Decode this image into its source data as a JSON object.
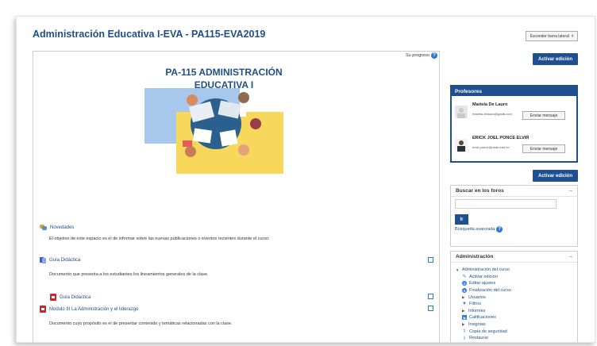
{
  "header": {
    "title": "Administración Educativa I-EVA - PA115-EVA2019",
    "hide_blocks_label": "Esconder barra lateral"
  },
  "main": {
    "progress_label": "Su progreso",
    "course_heading_line1": "PA-115 ADMINISTRACIÓN",
    "course_heading_line2": "EDUCATIVA I",
    "activities": [
      {
        "name": "Novedades",
        "description": "El objetivo de este espacio es el de informar sobre las nuevas publicaciones o eventos recientes durante el curso."
      },
      {
        "name": "Guía Didáctica",
        "description": "Documento que presenta a los estudiantes los lineamientos generales de la clase."
      },
      {
        "name": "Guía Didactica",
        "description": ""
      },
      {
        "name": "Modulo III La Administración y el liderazgo",
        "description": "Documento cuyo propósito es el de presentar contenido y temáticas relacionadas con la clase."
      }
    ]
  },
  "sidebar": {
    "activate_edit_label": "Activar edición",
    "teachers": {
      "title": "Profesores",
      "list": [
        {
          "name": "Mariela De Lauro",
          "email": "mariela.delauro@gmail.com",
          "message_label": "Enviar mensaje"
        },
        {
          "name": "ERICK JOEL PONCE ELVIR",
          "email": "erick.ponce@unah.edu.hn",
          "message_label": "Enviar mensaje"
        }
      ]
    },
    "forum_search": {
      "title": "Buscar en los foros",
      "go_label": "Ir",
      "advanced_label": "Búsqueda avanzada"
    },
    "admin": {
      "title": "Administración",
      "items": [
        {
          "label": "Administración del curso"
        },
        {
          "label": "Activar edición"
        },
        {
          "label": "Editar ajustes"
        },
        {
          "label": "Finalización del curso"
        },
        {
          "label": "Usuarios"
        },
        {
          "label": "Filtros"
        },
        {
          "label": "Informes"
        },
        {
          "label": "Calificaciones"
        },
        {
          "label": "Insignias"
        },
        {
          "label": "Copia de seguridad"
        },
        {
          "label": "Restaurar"
        }
      ]
    }
  },
  "colors": {
    "brand": "#1d4f91",
    "link": "#1f4f86",
    "pdf": "#c7282e",
    "hero_yellow": "#f7d85a",
    "hero_blue": "#a7c8ea"
  }
}
